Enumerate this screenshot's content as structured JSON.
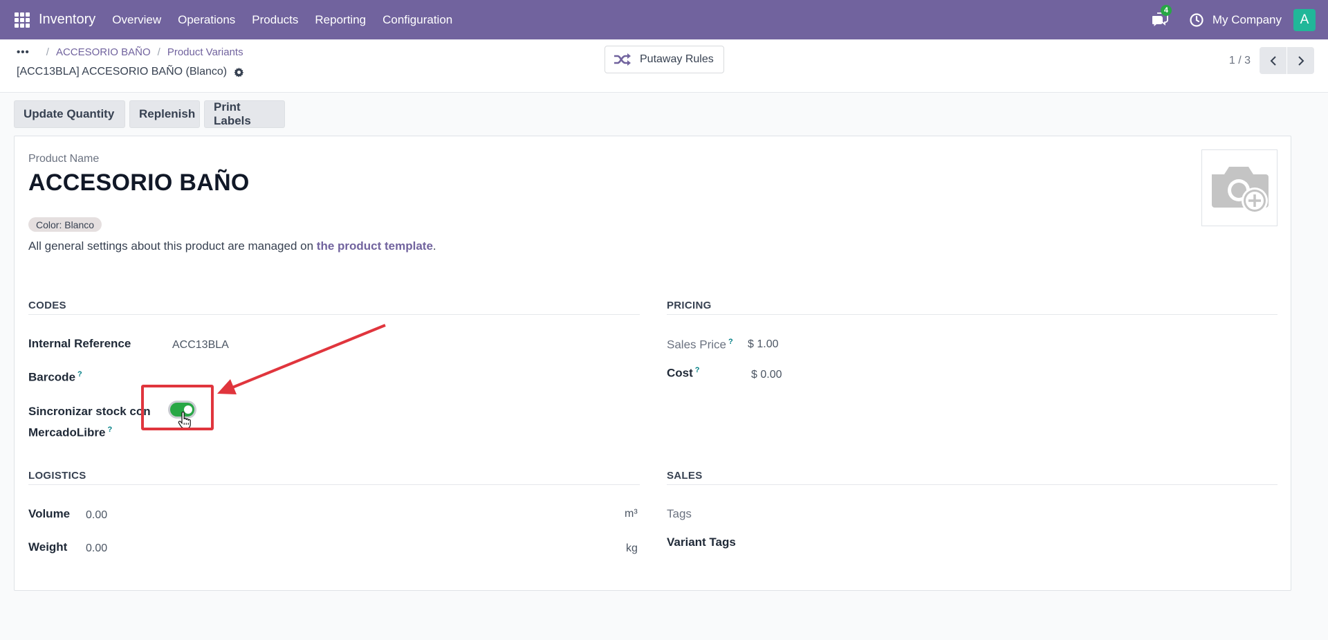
{
  "navbar": {
    "app_name": "Inventory",
    "menu": [
      "Overview",
      "Operations",
      "Products",
      "Reporting",
      "Configuration"
    ],
    "chat_count": "4",
    "company": "My Company",
    "avatar_letter": "A",
    "bg_color": "#71639e"
  },
  "breadcrumb": {
    "dots": "•••",
    "sep": "/",
    "items": [
      "ACCESORIO BAÑO",
      "Product Variants"
    ]
  },
  "record_title": "[ACC13BLA] ACCESORIO BAÑO (Blanco)",
  "putaway_label": "Putaway Rules",
  "pager": {
    "value": "1 / 3"
  },
  "actions": [
    "Update Quantity",
    "Replenish",
    "Print Labels"
  ],
  "form": {
    "name_hint": "Product Name",
    "product_name": "ACCESORIO BAÑO",
    "color_badge": "Color: Blanco",
    "template_note_prefix": "All general settings about this product are managed on",
    "template_link": "the product template",
    "template_note_suffix": ".",
    "codes": {
      "title": "CODES",
      "internal_ref_label": "Internal Reference",
      "internal_ref_value": "ACC13BLA",
      "barcode_label": "Barcode",
      "sync_label_line1": "Sincronizar stock con",
      "sync_label_line2": "MercadoLibre",
      "sync_enabled": true
    },
    "pricing": {
      "title": "PRICING",
      "sales_price_label": "Sales Price",
      "sales_price_value": "$ 1.00",
      "cost_label": "Cost",
      "cost_value": "$ 0.00"
    },
    "logistics": {
      "title": "LOGISTICS",
      "volume_label": "Volume",
      "volume_value": "0.00",
      "volume_unit": "m³",
      "weight_label": "Weight",
      "weight_value": "0.00",
      "weight_unit": "kg"
    },
    "sales": {
      "title": "SALES",
      "tags_label": "Tags",
      "variant_tags_label": "Variant Tags"
    },
    "help_mark": "?"
  },
  "annotation_color": "#e0353d"
}
